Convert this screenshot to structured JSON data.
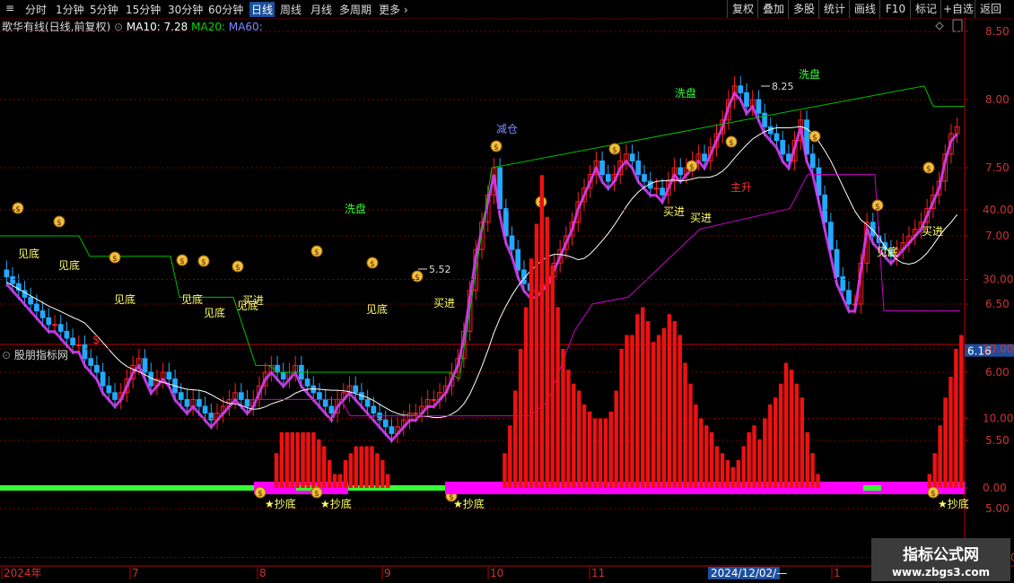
{
  "toolbar": {
    "left": [
      {
        "label": "分时",
        "active": false
      },
      {
        "label": "1分钟",
        "active": false
      },
      {
        "label": "5分钟",
        "active": false
      },
      {
        "label": "15分钟",
        "active": false
      },
      {
        "label": "30分钟",
        "active": false
      },
      {
        "label": "60分钟",
        "active": false
      },
      {
        "label": "日线",
        "active": true
      },
      {
        "label": "周线",
        "active": false
      },
      {
        "label": "月线",
        "active": false
      },
      {
        "label": "多周期",
        "active": false
      },
      {
        "label": "更多",
        "active": false
      }
    ],
    "right": [
      "复权",
      "叠加",
      "多股",
      "统计",
      "画线",
      "F10",
      "标记",
      "+自选",
      "返回"
    ]
  },
  "main": {
    "title": "歌华有线(日线,前复权)",
    "ma10_label": "MA10: 7.28",
    "ma20_label": "MA20:",
    "ma60_label": "MA60:",
    "price_ticks": [
      "8.50",
      "8.00",
      "7.50",
      "7.00",
      "6.50",
      "6.00",
      "5.50",
      "5.00"
    ],
    "current_price": "6.16",
    "high_label": "8.25",
    "low_label": "5.52"
  },
  "annotations": {
    "jiandi": "见底",
    "maijin": "买进",
    "xipan": "洗盘",
    "jiancang": "减仓",
    "zhusheng": "主升",
    "dollar": "$"
  },
  "sub": {
    "title": "股朋指标网",
    "ticks": [
      "40.00",
      "30.00",
      "20.00",
      "10.00",
      "0.00",
      "-10.00"
    ],
    "chaodi_label": "★抄底"
  },
  "date_axis": {
    "labels": [
      "2024年",
      "7",
      "8",
      "9",
      "10",
      "11",
      "1"
    ],
    "cursor_date": "2024/12/02/—"
  },
  "watermark": {
    "line1": "指标公式网",
    "line2": "www.zbgs3.com"
  },
  "colors": {
    "up": "#ff2020",
    "down": "#22aaff",
    "ma20": "#00dd00",
    "ma60": "#7b8cff",
    "magenta": "#ff00ff",
    "green": "#33ff33",
    "grid": "#800000"
  },
  "chart_data": {
    "type": "candlestick",
    "y_range": [
      4.9,
      8.8
    ],
    "closes": [
      6.7,
      6.65,
      6.6,
      6.55,
      6.5,
      6.45,
      6.4,
      6.35,
      6.35,
      6.3,
      6.25,
      6.2,
      6.2,
      6.1,
      6.05,
      6.0,
      5.9,
      5.85,
      5.8,
      5.85,
      5.95,
      6.05,
      6.1,
      6.0,
      5.9,
      5.95,
      6.0,
      5.95,
      5.85,
      5.8,
      5.75,
      5.8,
      5.75,
      5.7,
      5.65,
      5.7,
      5.75,
      5.8,
      5.85,
      5.8,
      5.75,
      5.8,
      5.9,
      6.0,
      6.05,
      6.0,
      5.95,
      6.0,
      6.05,
      5.95,
      5.9,
      5.85,
      5.8,
      5.75,
      5.7,
      5.8,
      5.85,
      5.9,
      5.85,
      5.8,
      5.75,
      5.7,
      5.65,
      5.6,
      5.55,
      5.6,
      5.65,
      5.7,
      5.7,
      5.75,
      5.8,
      5.8,
      5.85,
      5.9,
      6.0,
      6.1,
      6.3,
      6.6,
      6.9,
      7.1,
      7.3,
      7.5,
      7.2,
      7.0,
      6.9,
      6.75,
      6.65,
      6.6,
      6.6,
      6.65,
      6.7,
      6.8,
      6.9,
      7.0,
      7.1,
      7.25,
      7.35,
      7.45,
      7.55,
      7.45,
      7.4,
      7.45,
      7.55,
      7.6,
      7.55,
      7.45,
      7.4,
      7.35,
      7.35,
      7.3,
      7.4,
      7.5,
      7.45,
      7.5,
      7.55,
      7.6,
      7.55,
      7.65,
      7.75,
      7.85,
      8.0,
      8.1,
      8.05,
      7.95,
      8.0,
      7.9,
      7.8,
      7.75,
      7.7,
      7.6,
      7.55,
      7.7,
      7.85,
      7.6,
      7.5,
      7.3,
      7.1,
      6.9,
      6.7,
      6.6,
      6.5,
      6.5,
      6.8,
      7.1,
      7.0,
      6.95,
      6.9,
      6.85,
      6.9,
      6.95,
      7.0,
      7.05,
      7.1,
      7.2,
      7.3,
      7.4,
      7.6,
      7.75,
      7.8
    ],
    "sub_values": [
      0,
      0,
      0,
      0,
      0,
      0,
      0,
      0,
      0,
      0,
      0,
      0,
      0,
      0,
      0,
      0,
      0,
      0,
      0,
      0,
      0,
      0,
      0,
      0,
      0,
      0,
      0,
      0,
      0,
      0,
      0,
      0,
      0,
      0,
      0,
      0,
      0,
      0,
      0,
      0,
      0,
      0,
      0,
      0,
      0,
      0,
      0,
      0,
      0,
      0,
      0,
      5,
      8,
      8,
      8,
      8,
      8,
      8,
      8,
      7,
      6,
      4,
      2,
      2,
      4,
      5,
      6,
      6,
      6,
      6,
      5,
      4,
      2,
      0,
      0,
      0,
      0,
      0,
      0,
      0,
      0,
      0,
      0,
      0,
      0,
      0,
      0,
      0,
      0,
      0,
      0,
      0,
      0,
      0,
      5,
      9,
      14,
      20,
      26,
      33,
      38,
      45,
      39,
      32,
      26,
      20,
      17,
      15,
      14,
      12,
      11,
      10,
      10,
      10,
      11,
      14,
      20,
      22,
      22,
      25,
      26,
      24,
      21,
      22,
      23,
      25,
      24,
      22,
      18,
      15,
      12,
      10,
      9,
      8,
      6,
      5,
      4,
      3,
      4,
      6,
      8,
      9,
      7,
      10,
      12,
      13,
      15,
      18,
      17,
      15,
      13,
      8,
      5,
      2,
      0,
      0,
      0,
      0,
      0,
      0,
      0,
      0,
      0,
      0,
      0,
      0,
      0,
      0,
      0,
      0,
      0,
      0,
      0,
      0,
      2,
      5,
      9,
      13,
      16,
      20,
      22
    ]
  }
}
